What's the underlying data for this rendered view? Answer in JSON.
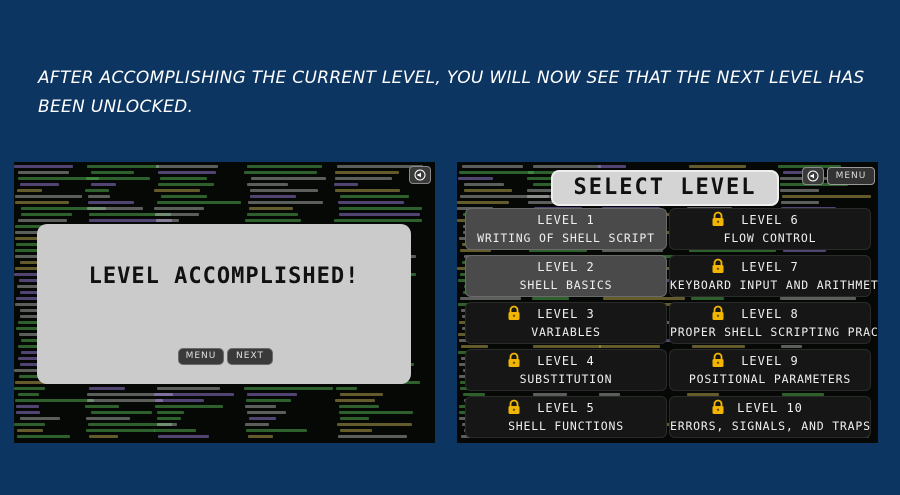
{
  "caption": "AFTER ACCOMPLISHING THE CURRENT LEVEL, YOU WILL NOW SEE THAT THE NEXT LEVEL HAS BEEN UNLOCKED.",
  "left_screen": {
    "dialog_title": "LEVEL ACCOMPLISHED!",
    "menu_label": "MENU",
    "next_label": "NEXT",
    "sound_icon": "speaker-icon"
  },
  "right_screen": {
    "title": "SELECT LEVEL",
    "menu_label": "MENU",
    "sound_icon": "speaker-icon",
    "lock_icon": "padlock-icon",
    "levels": [
      {
        "number": "LEVEL 1",
        "name": "WRITING OF SHELL SCRIPT",
        "locked": false
      },
      {
        "number": "LEVEL 6",
        "name": "FLOW CONTROL",
        "locked": true
      },
      {
        "number": "LEVEL 2",
        "name": "SHELL BASICS",
        "locked": false
      },
      {
        "number": "LEVEL 7",
        "name": "KEYBOARD INPUT AND ARITHMETIC",
        "locked": true
      },
      {
        "number": "LEVEL 3",
        "name": "VARIABLES",
        "locked": true
      },
      {
        "number": "LEVEL 8",
        "name": "PROPER SHELL SCRIPTING PRACTICES",
        "locked": true
      },
      {
        "number": "LEVEL 4",
        "name": "SUBSTITUTION",
        "locked": true
      },
      {
        "number": "LEVEL 9",
        "name": "POSITIONAL PARAMETERS",
        "locked": true
      },
      {
        "number": "LEVEL 5",
        "name": "SHELL FUNCTIONS",
        "locked": true
      },
      {
        "number": "LEVEL 10",
        "name": "ERRORS, SIGNALS, AND TRAPS",
        "locked": true
      }
    ]
  },
  "colors": {
    "background": "#0d3561",
    "dialog": "#cbcbcb",
    "card_unlocked": "#4a4a4a",
    "card_locked": "#161616",
    "lock": "#f2b600"
  }
}
